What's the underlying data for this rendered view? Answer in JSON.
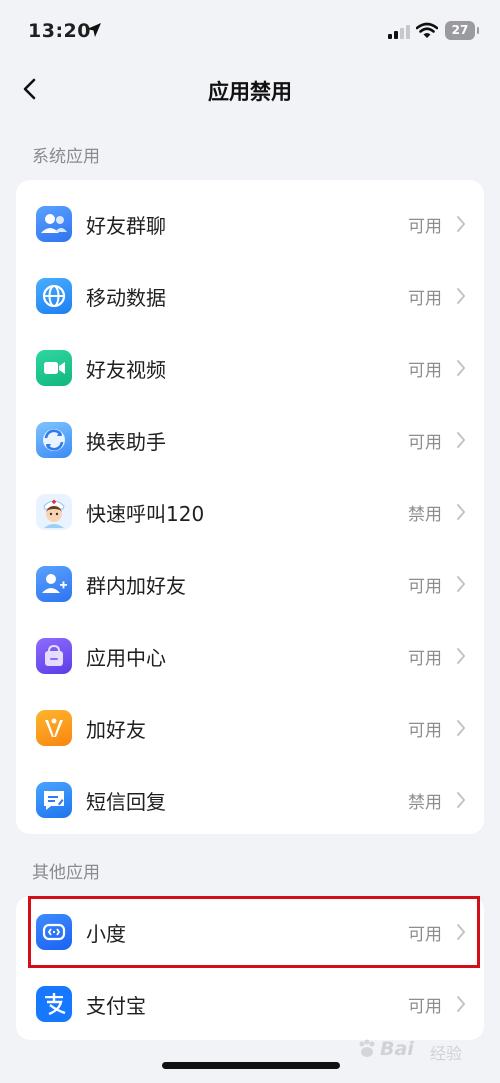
{
  "status_bar": {
    "time": "13:20",
    "battery": "27"
  },
  "nav": {
    "title": "应用禁用"
  },
  "sections": [
    {
      "title": "系统应用",
      "items": [
        {
          "name": "好友群聊",
          "status": "可用",
          "icon": "friend-group-chat-icon"
        },
        {
          "name": "移动数据",
          "status": "可用",
          "icon": "mobile-data-globe-icon"
        },
        {
          "name": "好友视频",
          "status": "可用",
          "icon": "video-camera-icon"
        },
        {
          "name": "换表助手",
          "status": "可用",
          "icon": "watch-swap-icon"
        },
        {
          "name": "快速呼叫120",
          "status": "禁用",
          "icon": "nurse-avatar-icon"
        },
        {
          "name": "群内加好友",
          "status": "可用",
          "icon": "add-friend-icon"
        },
        {
          "name": "应用中心",
          "status": "可用",
          "icon": "app-center-bag-icon"
        },
        {
          "name": "加好友",
          "status": "可用",
          "icon": "add-friend-v-icon"
        },
        {
          "name": "短信回复",
          "status": "禁用",
          "icon": "sms-reply-icon"
        }
      ]
    },
    {
      "title": "其他应用",
      "items": [
        {
          "name": "小度",
          "status": "可用",
          "icon": "xiaodu-icon"
        },
        {
          "name": "支付宝",
          "status": "可用",
          "icon": "alipay-icon"
        }
      ]
    }
  ],
  "watermark": {
    "brand": "Bai",
    "sub": "经验"
  },
  "colors": {
    "background": "#f2f3f7",
    "card": "#ffffff",
    "highlight_border": "#d40e16",
    "status_text": "#8d8d92"
  }
}
